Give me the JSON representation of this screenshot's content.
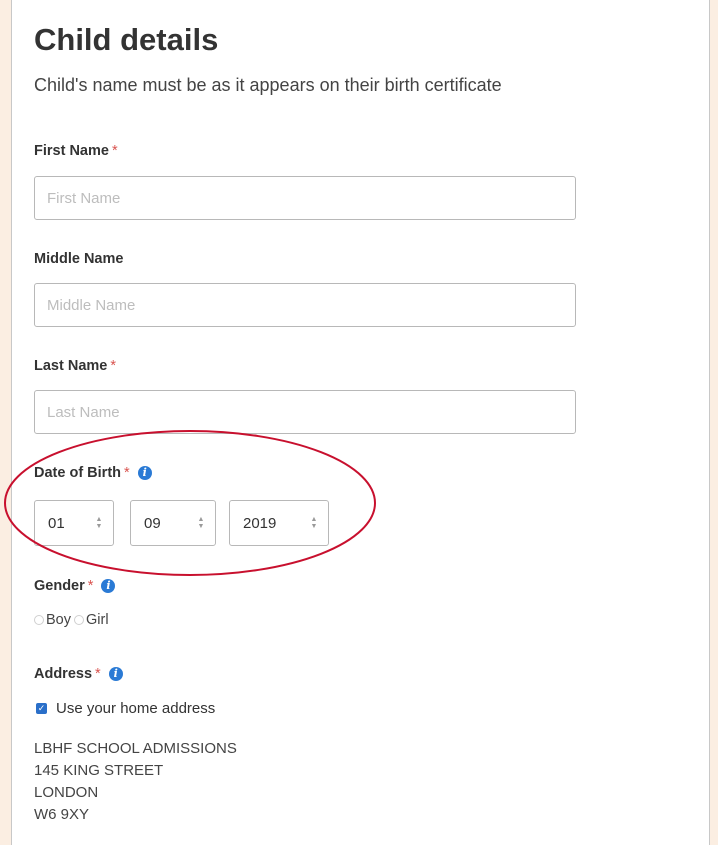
{
  "form": {
    "title": "Child details",
    "subtitle": "Child's name must be as it appears on their birth certificate",
    "required_marker": "*",
    "first_name": {
      "label": "First Name",
      "placeholder": "First Name",
      "value": ""
    },
    "middle_name": {
      "label": "Middle Name",
      "placeholder": "Middle Name",
      "value": ""
    },
    "last_name": {
      "label": "Last Name",
      "placeholder": "Last Name",
      "value": ""
    },
    "dob": {
      "label": "Date of Birth",
      "day": "01",
      "month": "09",
      "year": "2019"
    },
    "gender": {
      "label": "Gender",
      "options": [
        "Boy",
        "Girl"
      ]
    },
    "address": {
      "label": "Address",
      "use_home_label": "Use your home address",
      "use_home_checked": true,
      "lines": [
        "LBHF SCHOOL ADMISSIONS",
        "145 KING STREET",
        "LONDON",
        "W6 9XY"
      ]
    }
  },
  "colors": {
    "page_background": "#fbeee2",
    "required": "#d9534f",
    "info_icon": "#2a7ad5",
    "annotation_circle": "#c8102e"
  }
}
